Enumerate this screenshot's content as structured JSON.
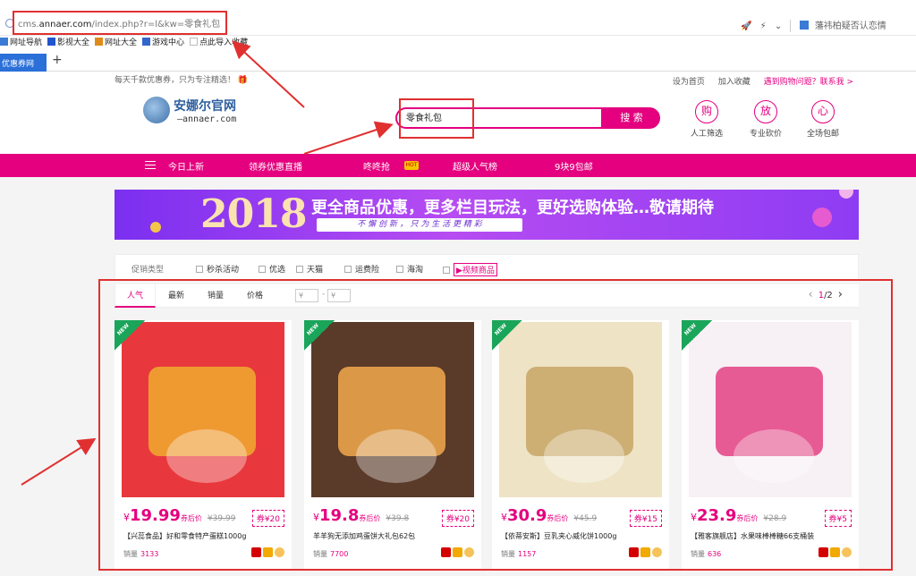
{
  "browser": {
    "url_prefix": "cms.",
    "url_domain": "annaer.com",
    "url_path": "/index.php?r=l&kw=零食礼包",
    "right_search_text": "藩祎柏疑否认恋情",
    "bookmarks": [
      {
        "label": "网址导航",
        "icon": "globe-icon",
        "color": "#3a7bd5"
      },
      {
        "label": "影视大全",
        "icon": "film-icon",
        "color": "#2255cc"
      },
      {
        "label": "网址大全",
        "icon": "directory-icon",
        "color": "#e08a1a"
      },
      {
        "label": "游戏中心",
        "icon": "gamepad-icon",
        "color": "#3366cc"
      },
      {
        "label": "点此导入收藏",
        "icon": "import-icon",
        "color": "#ffffff"
      }
    ],
    "active_tab_label": "优惠券网",
    "new_tab_symbol": "+"
  },
  "header": {
    "slogan": "每天千款优惠券，只为专注精选！",
    "top_links": [
      "设为首页",
      "加入收藏"
    ],
    "help_link": "遇到购物问题？联系我 >",
    "logo_title": "安娜尔官网",
    "logo_subtitle": "—annaer.com",
    "search_value": "零食礼包",
    "search_button": "搜 索",
    "features": [
      {
        "char": "购",
        "label": "人工筛选"
      },
      {
        "char": "放",
        "label": "专业砍价"
      },
      {
        "char": "心",
        "label": "全场包邮"
      }
    ]
  },
  "nav": {
    "items": [
      "今日上新",
      "领券优惠直播",
      "咚咚抢",
      "超级人气榜",
      "9块9包邮"
    ],
    "hot_badge": "HOT"
  },
  "banner": {
    "year": "2018",
    "title": "更全商品优惠，更多栏目玩法，更好选购体验…敬请期待",
    "subtitle": "不 懈 创 新 ， 只 为 生 活 更 精 彩"
  },
  "filter": {
    "label": "促销类型",
    "options": [
      "秒杀活动",
      "优选",
      "天猫",
      "运费险",
      "海淘",
      "视频商品"
    ]
  },
  "sort": {
    "tabs": [
      "人气",
      "最新",
      "销量",
      "价格"
    ],
    "active": "人气",
    "price_from": "¥",
    "price_to": "¥",
    "dash": "-",
    "page_current": "1",
    "page_total": "/2",
    "prev": "‹",
    "next": "›"
  },
  "products": [
    {
      "new": "NEW",
      "yen": "¥",
      "price": "19.99",
      "after": "券后价",
      "orig": "¥39.99",
      "coupon": "券¥20",
      "title": "【兴蕊食品】好和零食特产蛋糕1000g",
      "sold_label": "销量",
      "sold": "3133",
      "img_bg": "#e8383d",
      "img_fg": "#f0a530"
    },
    {
      "new": "NEW",
      "yen": "¥",
      "price": "19.8",
      "after": "券后价",
      "orig": "¥39.8",
      "coupon": "券¥20",
      "title": "羊羊狗无添加鸡蛋饼大礼包62包",
      "sold_label": "销量",
      "sold": "7700",
      "img_bg": "#5a3a28",
      "img_fg": "#e9a44a"
    },
    {
      "new": "NEW",
      "yen": "¥",
      "price": "30.9",
      "after": "券后价",
      "orig": "¥45.9",
      "coupon": "券¥15",
      "title": "【依蒂安斯】豆乳夹心威化饼1000g",
      "sold_label": "销量",
      "sold": "1157",
      "img_bg": "#efe3c5",
      "img_fg": "#c9a86a"
    },
    {
      "new": "NEW",
      "yen": "¥",
      "price": "23.9",
      "after": "券后价",
      "orig": "¥28.9",
      "coupon": "券¥5",
      "title": "【雅客旗舰店】水果味棒棒糖66支桶装",
      "sold_label": "销量",
      "sold": "636",
      "img_bg": "#f7f0f5",
      "img_fg": "#e44a8a"
    }
  ],
  "colors": {
    "accent": "#e4007f",
    "annotation": "#e03030",
    "tab_blue": "#2b6fd8"
  }
}
